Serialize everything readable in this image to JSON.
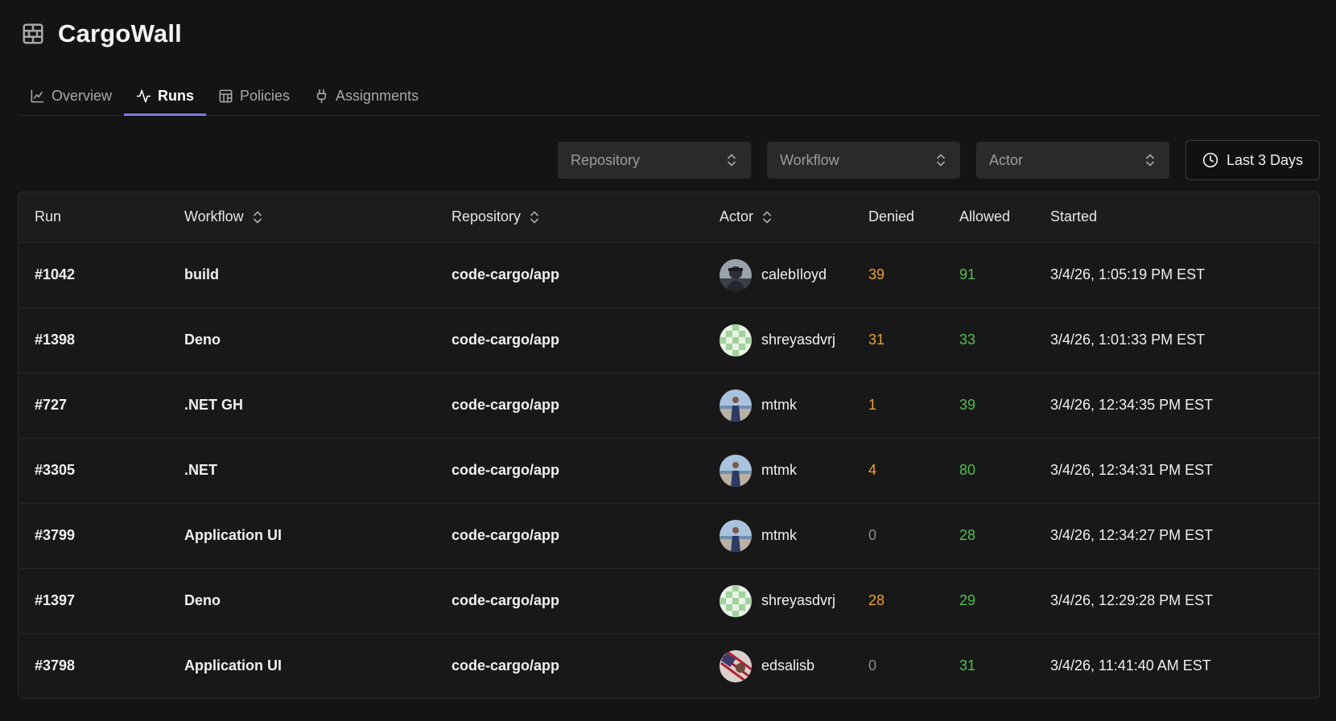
{
  "app": {
    "title": "CargoWall"
  },
  "tabs": [
    {
      "label": "Overview",
      "icon": "line-chart-icon",
      "active": false
    },
    {
      "label": "Runs",
      "icon": "activity-icon",
      "active": true
    },
    {
      "label": "Policies",
      "icon": "layout-grid-icon",
      "active": false
    },
    {
      "label": "Assignments",
      "icon": "plug-icon",
      "active": false
    }
  ],
  "filters": {
    "repository": "Repository",
    "workflow": "Workflow",
    "actor": "Actor",
    "date_range": "Last 3 Days"
  },
  "table": {
    "headers": {
      "run": "Run",
      "workflow": "Workflow",
      "repository": "Repository",
      "actor": "Actor",
      "denied": "Denied",
      "allowed": "Allowed",
      "started": "Started"
    },
    "rows": [
      {
        "run": "#1042",
        "workflow": "build",
        "repository": "code-cargo/app",
        "actor": "calebIloyd",
        "avatar": "photo-avatar-dark",
        "denied": "39",
        "allowed": "91",
        "started": "3/4/26, 1:05:19 PM EST"
      },
      {
        "run": "#1398",
        "workflow": "Deno",
        "repository": "code-cargo/app",
        "actor": "shreyasdvrj",
        "avatar": "identicon-avatar-green",
        "denied": "31",
        "allowed": "33",
        "started": "3/4/26, 1:01:33 PM EST"
      },
      {
        "run": "#727",
        "workflow": ".NET GH",
        "repository": "code-cargo/app",
        "actor": "mtmk",
        "avatar": "photo-avatar-beach",
        "denied": "1",
        "allowed": "39",
        "started": "3/4/26, 12:34:35 PM EST"
      },
      {
        "run": "#3305",
        "workflow": ".NET",
        "repository": "code-cargo/app",
        "actor": "mtmk",
        "avatar": "photo-avatar-beach",
        "denied": "4",
        "allowed": "80",
        "started": "3/4/26, 12:34:31 PM EST"
      },
      {
        "run": "#3799",
        "workflow": "Application UI",
        "repository": "code-cargo/app",
        "actor": "mtmk",
        "avatar": "photo-avatar-beach",
        "denied": "0",
        "allowed": "28",
        "started": "3/4/26, 12:34:27 PM EST"
      },
      {
        "run": "#1397",
        "workflow": "Deno",
        "repository": "code-cargo/app",
        "actor": "shreyasdvrj",
        "avatar": "identicon-avatar-green",
        "denied": "28",
        "allowed": "29",
        "started": "3/4/26, 12:29:28 PM EST"
      },
      {
        "run": "#3798",
        "workflow": "Application UI",
        "repository": "code-cargo/app",
        "actor": "edsalisb",
        "avatar": "photo-avatar-flag",
        "denied": "0",
        "allowed": "31",
        "started": "3/4/26, 11:41:40 AM EST"
      }
    ]
  },
  "colors": {
    "accent": "#7b7be8",
    "denied": "#f0a21f",
    "denied_zero": "#8a8a8a",
    "allowed": "#4cc14c",
    "background": "#141414"
  }
}
